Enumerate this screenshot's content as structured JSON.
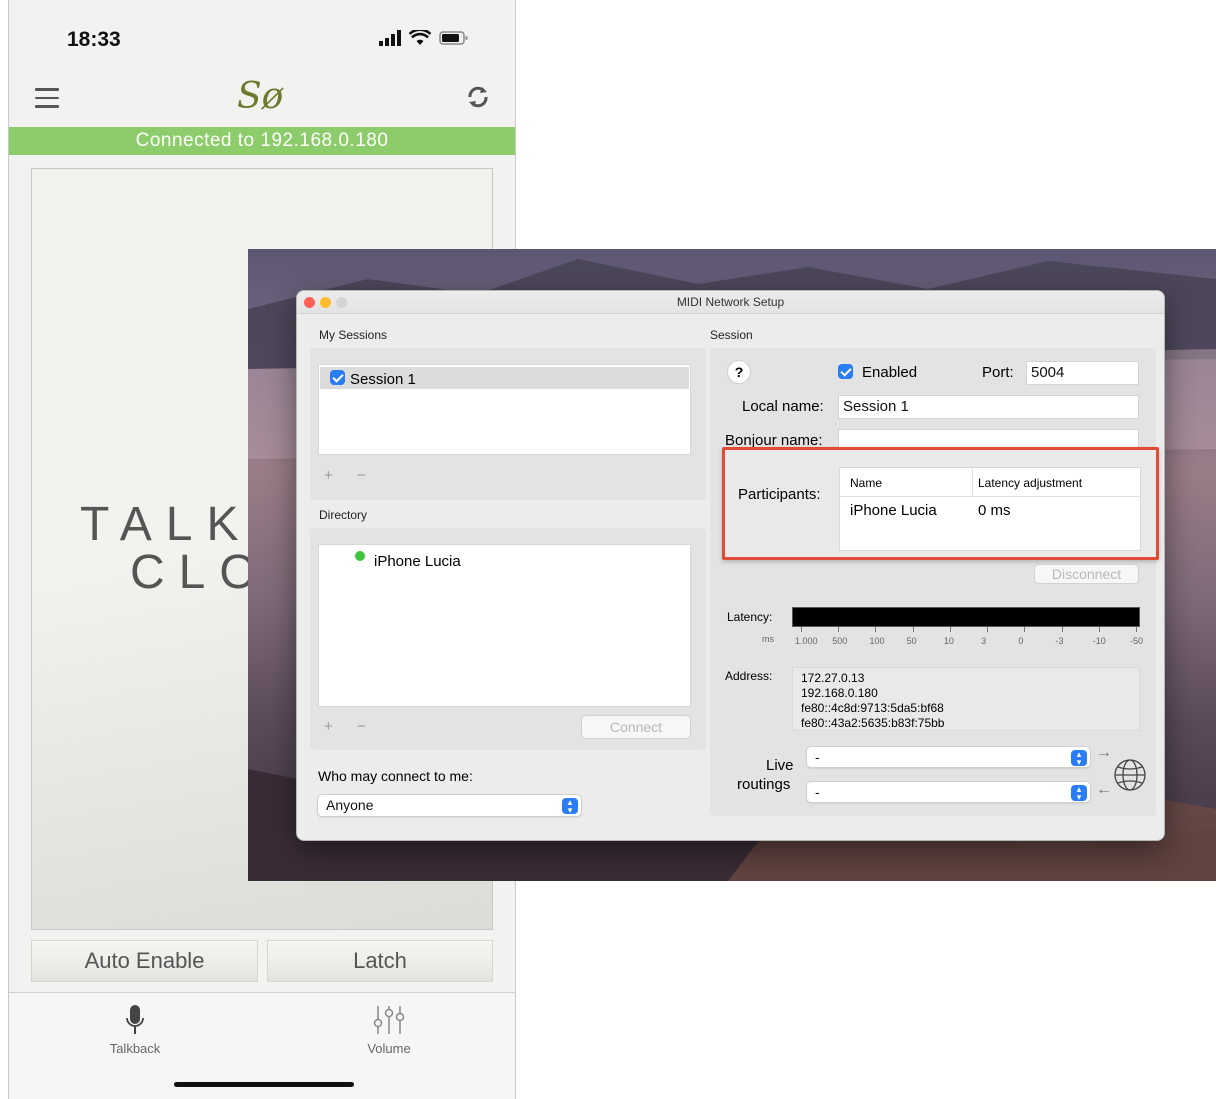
{
  "phone": {
    "status_time": "18:33",
    "logo_text": "Sø",
    "connection_banner": "Connected to 192.168.0.180",
    "talk_line1": "TALK",
    "talk_line2": "CLO",
    "buttons": {
      "auto_enable": "Auto Enable",
      "latch": "Latch"
    },
    "tabs": [
      {
        "label": "Talkback",
        "icon": "microphone-icon"
      },
      {
        "label": "Volume",
        "icon": "sliders-icon"
      }
    ],
    "colors": {
      "banner": "#8ccc6a",
      "logo": "#6b7a2c"
    }
  },
  "midi_window": {
    "title": "MIDI Network Setup",
    "my_sessions": {
      "heading": "My Sessions",
      "items": [
        {
          "label": "Session 1",
          "checked": true
        }
      ],
      "add_remove": "+ −"
    },
    "directory": {
      "heading": "Directory",
      "items": [
        {
          "label": "iPhone Lucia",
          "status": "online"
        }
      ],
      "add_remove": "+ −",
      "connect_label": "Connect"
    },
    "who_may_connect": {
      "label": "Who may connect to me:",
      "value": "Anyone"
    },
    "session": {
      "heading": "Session",
      "help": "?",
      "enabled_label": "Enabled",
      "port_label": "Port:",
      "port_value": "5004",
      "local_name_label": "Local name:",
      "local_name_value": "Session 1",
      "bonjour_name_label": "Bonjour name:",
      "participants_label": "Participants:",
      "participants_columns": [
        "Name",
        "Latency adjustment"
      ],
      "participants_rows": [
        {
          "name": "iPhone Lucia",
          "latency": "0 ms"
        }
      ],
      "disconnect_label": "Disconnect",
      "latency_label": "Latency:",
      "latency_unit": "ms",
      "latency_ticks": [
        "1.000",
        "500",
        "100",
        "50",
        "10",
        "3",
        "0",
        "-3",
        "-10",
        "-50"
      ],
      "address_label": "Address:",
      "addresses": [
        "172.27.0.13",
        "192.168.0.180",
        "fe80::4c8d:9713:5da5:bf68",
        "fe80::43a2:5635:b83f:75bb"
      ],
      "live_routings_label_1": "Live",
      "live_routings_label_2": "routings",
      "routing_in": "-",
      "routing_out": "-",
      "routing_in_arrow": "→",
      "routing_out_arrow": "←"
    },
    "colors": {
      "accent": "#2a7df5",
      "highlight_border": "#e04a36",
      "online_dot": "#3ec43e"
    }
  }
}
